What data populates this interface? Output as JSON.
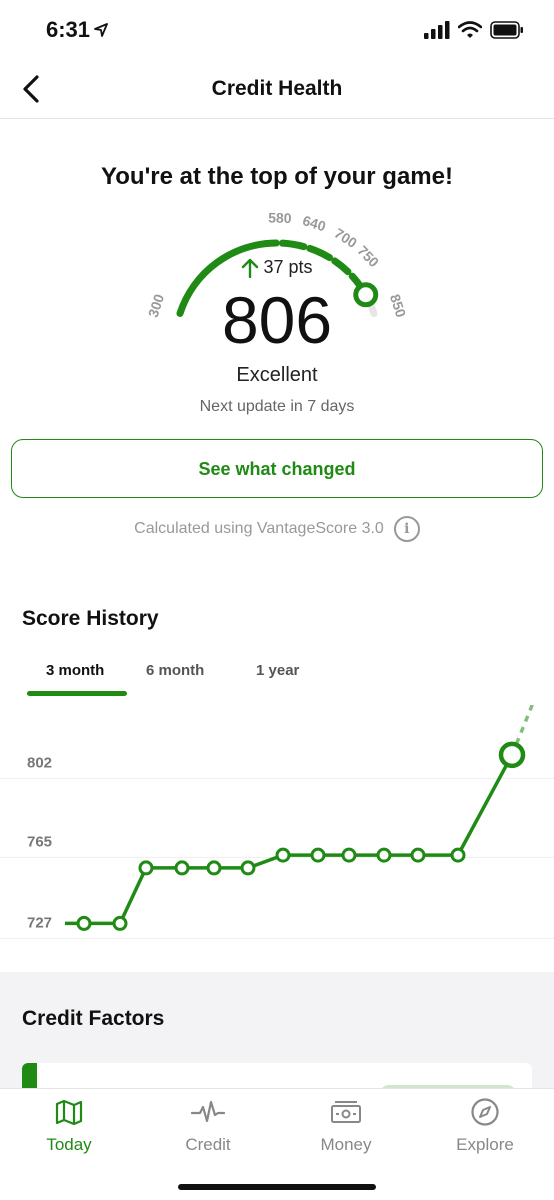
{
  "status_bar": {
    "time": "6:31"
  },
  "nav": {
    "title": "Credit Health"
  },
  "headline": "You're at the top of your game!",
  "gauge": {
    "score": "806",
    "score_value": 806,
    "change": "37 pts",
    "rating": "Excellent",
    "next_update": "Next update in 7 days",
    "range_min": 300,
    "range_max": 850,
    "ticks": [
      "300",
      "580",
      "640",
      "700",
      "750",
      "850"
    ],
    "accent_color": "#1f8a14"
  },
  "see_changed_label": "See what changed",
  "calculated_text": "Calculated using VantageScore 3.0",
  "score_history": {
    "title": "Score History",
    "tabs": [
      {
        "label": "3 month",
        "active": true
      },
      {
        "label": "6 month",
        "active": false
      },
      {
        "label": "1 year",
        "active": false
      }
    ]
  },
  "chart_data": {
    "type": "line",
    "y_ticks": [
      "802",
      "765",
      "727"
    ],
    "ylim": [
      715,
      820
    ],
    "series": [
      {
        "values": [
          727,
          727,
          727,
          753,
          753,
          753,
          753,
          759,
          759,
          759,
          759,
          759,
          759,
          806
        ]
      }
    ],
    "projection": [
      806,
      830
    ],
    "grid": true,
    "color": "#1f8a14"
  },
  "credit_factors": {
    "title": "Credit Factors"
  },
  "tab_bar": {
    "items": [
      {
        "label": "Today",
        "icon": "map-icon",
        "active": true
      },
      {
        "label": "Credit",
        "icon": "pulse-icon",
        "active": false
      },
      {
        "label": "Money",
        "icon": "money-icon",
        "active": false
      },
      {
        "label": "Explore",
        "icon": "compass-icon",
        "active": false
      }
    ]
  }
}
